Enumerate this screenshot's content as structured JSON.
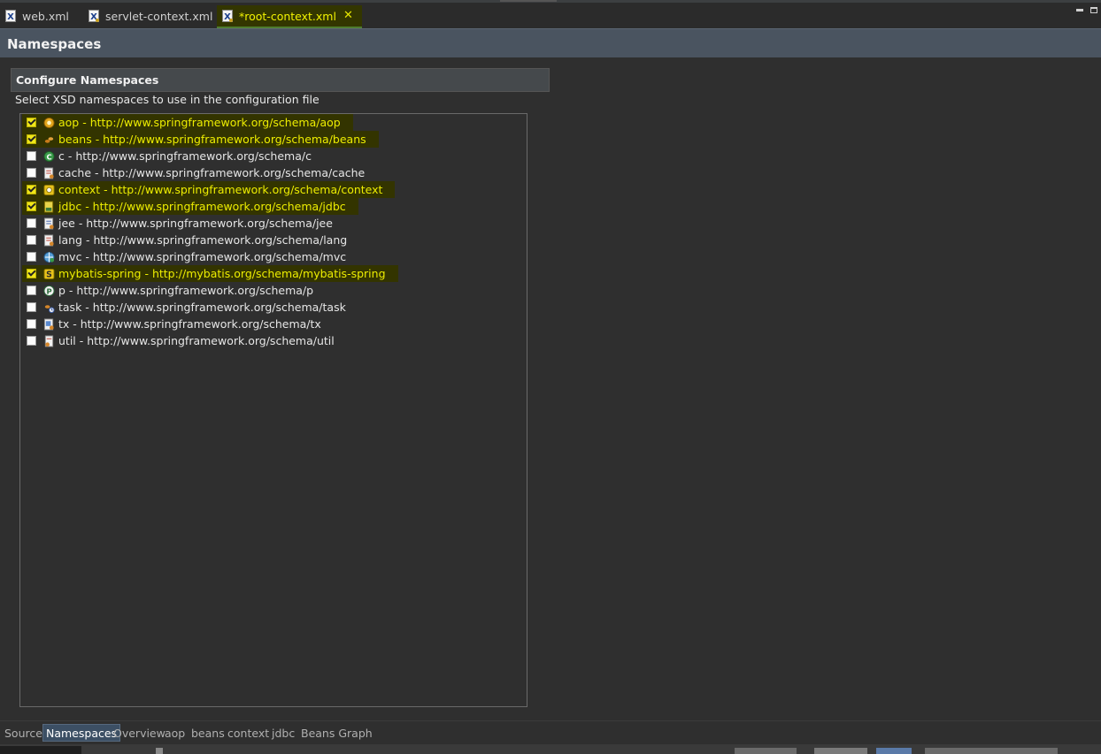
{
  "tabs": [
    {
      "label": "web.xml",
      "active": false,
      "icon": "xml-file-icon"
    },
    {
      "label": "servlet-context.xml",
      "active": false,
      "icon": "xml-file-icon"
    },
    {
      "label": "*root-context.xml",
      "active": true,
      "icon": "xml-file-icon"
    }
  ],
  "page": {
    "title": "Namespaces",
    "section_title": "Configure Namespaces",
    "section_desc": "Select XSD namespaces to use in the configuration file"
  },
  "namespaces": [
    {
      "label": "aop - http://www.springframework.org/schema/aop",
      "checked": true,
      "icon": "aop-namespace-icon"
    },
    {
      "label": "beans - http://www.springframework.org/schema/beans",
      "checked": true,
      "icon": "beans-namespace-icon"
    },
    {
      "label": "c - http://www.springframework.org/schema/c",
      "checked": false,
      "icon": "c-namespace-icon"
    },
    {
      "label": "cache - http://www.springframework.org/schema/cache",
      "checked": false,
      "icon": "cache-namespace-icon"
    },
    {
      "label": "context - http://www.springframework.org/schema/context",
      "checked": true,
      "icon": "context-namespace-icon"
    },
    {
      "label": "jdbc - http://www.springframework.org/schema/jdbc",
      "checked": true,
      "icon": "jdbc-namespace-icon"
    },
    {
      "label": "jee - http://www.springframework.org/schema/jee",
      "checked": false,
      "icon": "jee-namespace-icon"
    },
    {
      "label": "lang - http://www.springframework.org/schema/lang",
      "checked": false,
      "icon": "lang-namespace-icon"
    },
    {
      "label": "mvc - http://www.springframework.org/schema/mvc",
      "checked": false,
      "icon": "mvc-namespace-icon"
    },
    {
      "label": "mybatis-spring - http://mybatis.org/schema/mybatis-spring",
      "checked": true,
      "icon": "mybatis-namespace-icon"
    },
    {
      "label": "p - http://www.springframework.org/schema/p",
      "checked": false,
      "icon": "p-namespace-icon"
    },
    {
      "label": "task - http://www.springframework.org/schema/task",
      "checked": false,
      "icon": "task-namespace-icon"
    },
    {
      "label": "tx - http://www.springframework.org/schema/tx",
      "checked": false,
      "icon": "tx-namespace-icon"
    },
    {
      "label": "util - http://www.springframework.org/schema/util",
      "checked": false,
      "icon": "util-namespace-icon"
    }
  ],
  "bottom_tabs": [
    {
      "label": "Source",
      "active": false
    },
    {
      "label": "Namespaces",
      "active": true
    },
    {
      "label": "Overview",
      "active": false
    },
    {
      "label": "aop",
      "active": false
    },
    {
      "label": "beans",
      "active": false
    },
    {
      "label": "context",
      "active": false
    },
    {
      "label": "jdbc",
      "active": false
    },
    {
      "label": "Beans Graph",
      "active": false
    }
  ],
  "colors": {
    "highlight_text": "#eded00",
    "highlight_bg": "#333400",
    "header_bg": "#4a5460",
    "active_bottom_tab": "#3c4f64"
  }
}
